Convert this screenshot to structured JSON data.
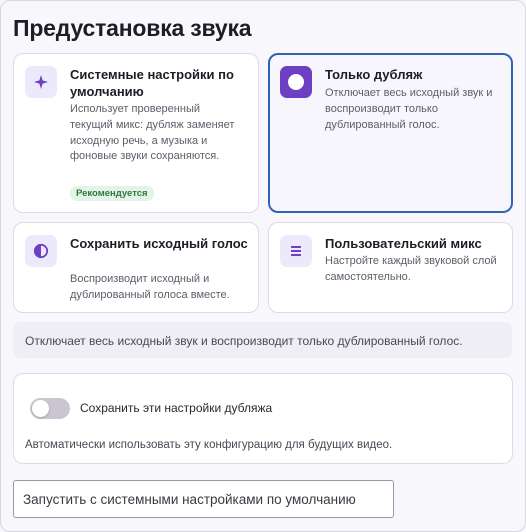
{
  "title": "Предустановка звука",
  "options": [
    {
      "title": "Системные настройки по умолчанию",
      "description": "Использует проверенный текущий микс: дубляж заменяет исходную речь, а музыка и фоновые звуки сохраняются.",
      "badge": "Рекомендуется",
      "icon": "sparkle-icon",
      "selected": false
    },
    {
      "title": "Только дубляж",
      "description": "Отключает весь исходный звук и воспроизводит только дублированный голос.",
      "icon": "record-circle-icon",
      "selected": true
    },
    {
      "title": "Сохранить исходный голос",
      "description": "Воспроизводит исходный и дублированный голоса вместе.",
      "icon": "half-circle-icon",
      "selected": false
    },
    {
      "title": "Пользовательский микс",
      "description": "Настройте каждый звуковой слой самостоятельно.",
      "icon": "equalizer-icon",
      "selected": false
    }
  ],
  "summary": "Отключает весь исходный звук и воспроизводит только дублированный голос.",
  "save_settings": {
    "label": "Сохранить эти настройки дубляжа",
    "enabled": false,
    "description": "Автоматически использовать эту конфигурацию для будущих видео."
  },
  "launch_button": "Запустить с системными настройками по умолчанию",
  "colors": {
    "accent": "#6c3fc4",
    "selected_border": "#2f64b3",
    "badge_bg": "#e4f3e7",
    "badge_text": "#2d7a3e"
  }
}
